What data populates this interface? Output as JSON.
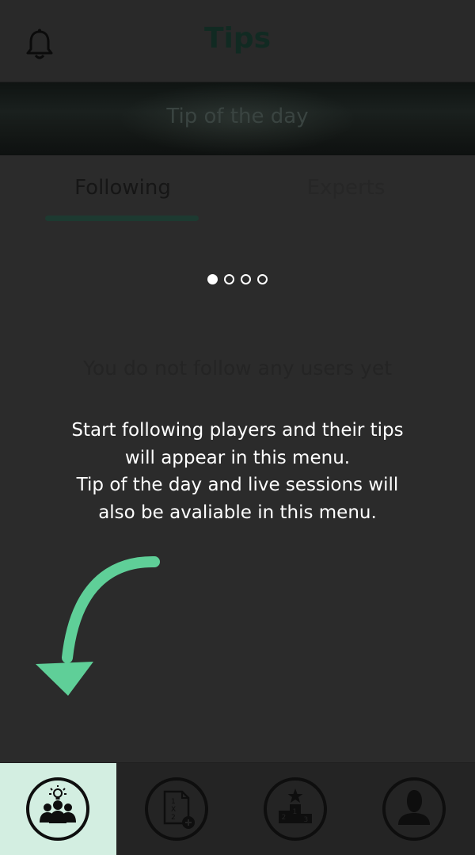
{
  "header": {
    "title": "Tips",
    "notification_icon": "bell-icon"
  },
  "banner": {
    "label": "Tip of the day"
  },
  "tabs": [
    {
      "label": "Following",
      "selected": true
    },
    {
      "label": "Experts",
      "selected": false
    }
  ],
  "pager": {
    "total": 4,
    "current": 1
  },
  "empty_state": {
    "title": "You do not follow any users yet"
  },
  "onboarding": {
    "lines": [
      "Start following players and their tips",
      "will appear in this menu.",
      "Tip of the day and live sessions will",
      "also be avaliable in this menu."
    ],
    "arrow_color": "#5fcf98"
  },
  "bottom_nav": [
    {
      "icon": "tipsters-group-icon",
      "active": true
    },
    {
      "icon": "betslip-1x2-add-icon",
      "active": false
    },
    {
      "icon": "leaderboard-podium-icon",
      "active": false
    },
    {
      "icon": "profile-user-icon",
      "active": false
    }
  ],
  "colors": {
    "accent_active_bg": "#d3eee1",
    "background": "#2b2b2b"
  }
}
